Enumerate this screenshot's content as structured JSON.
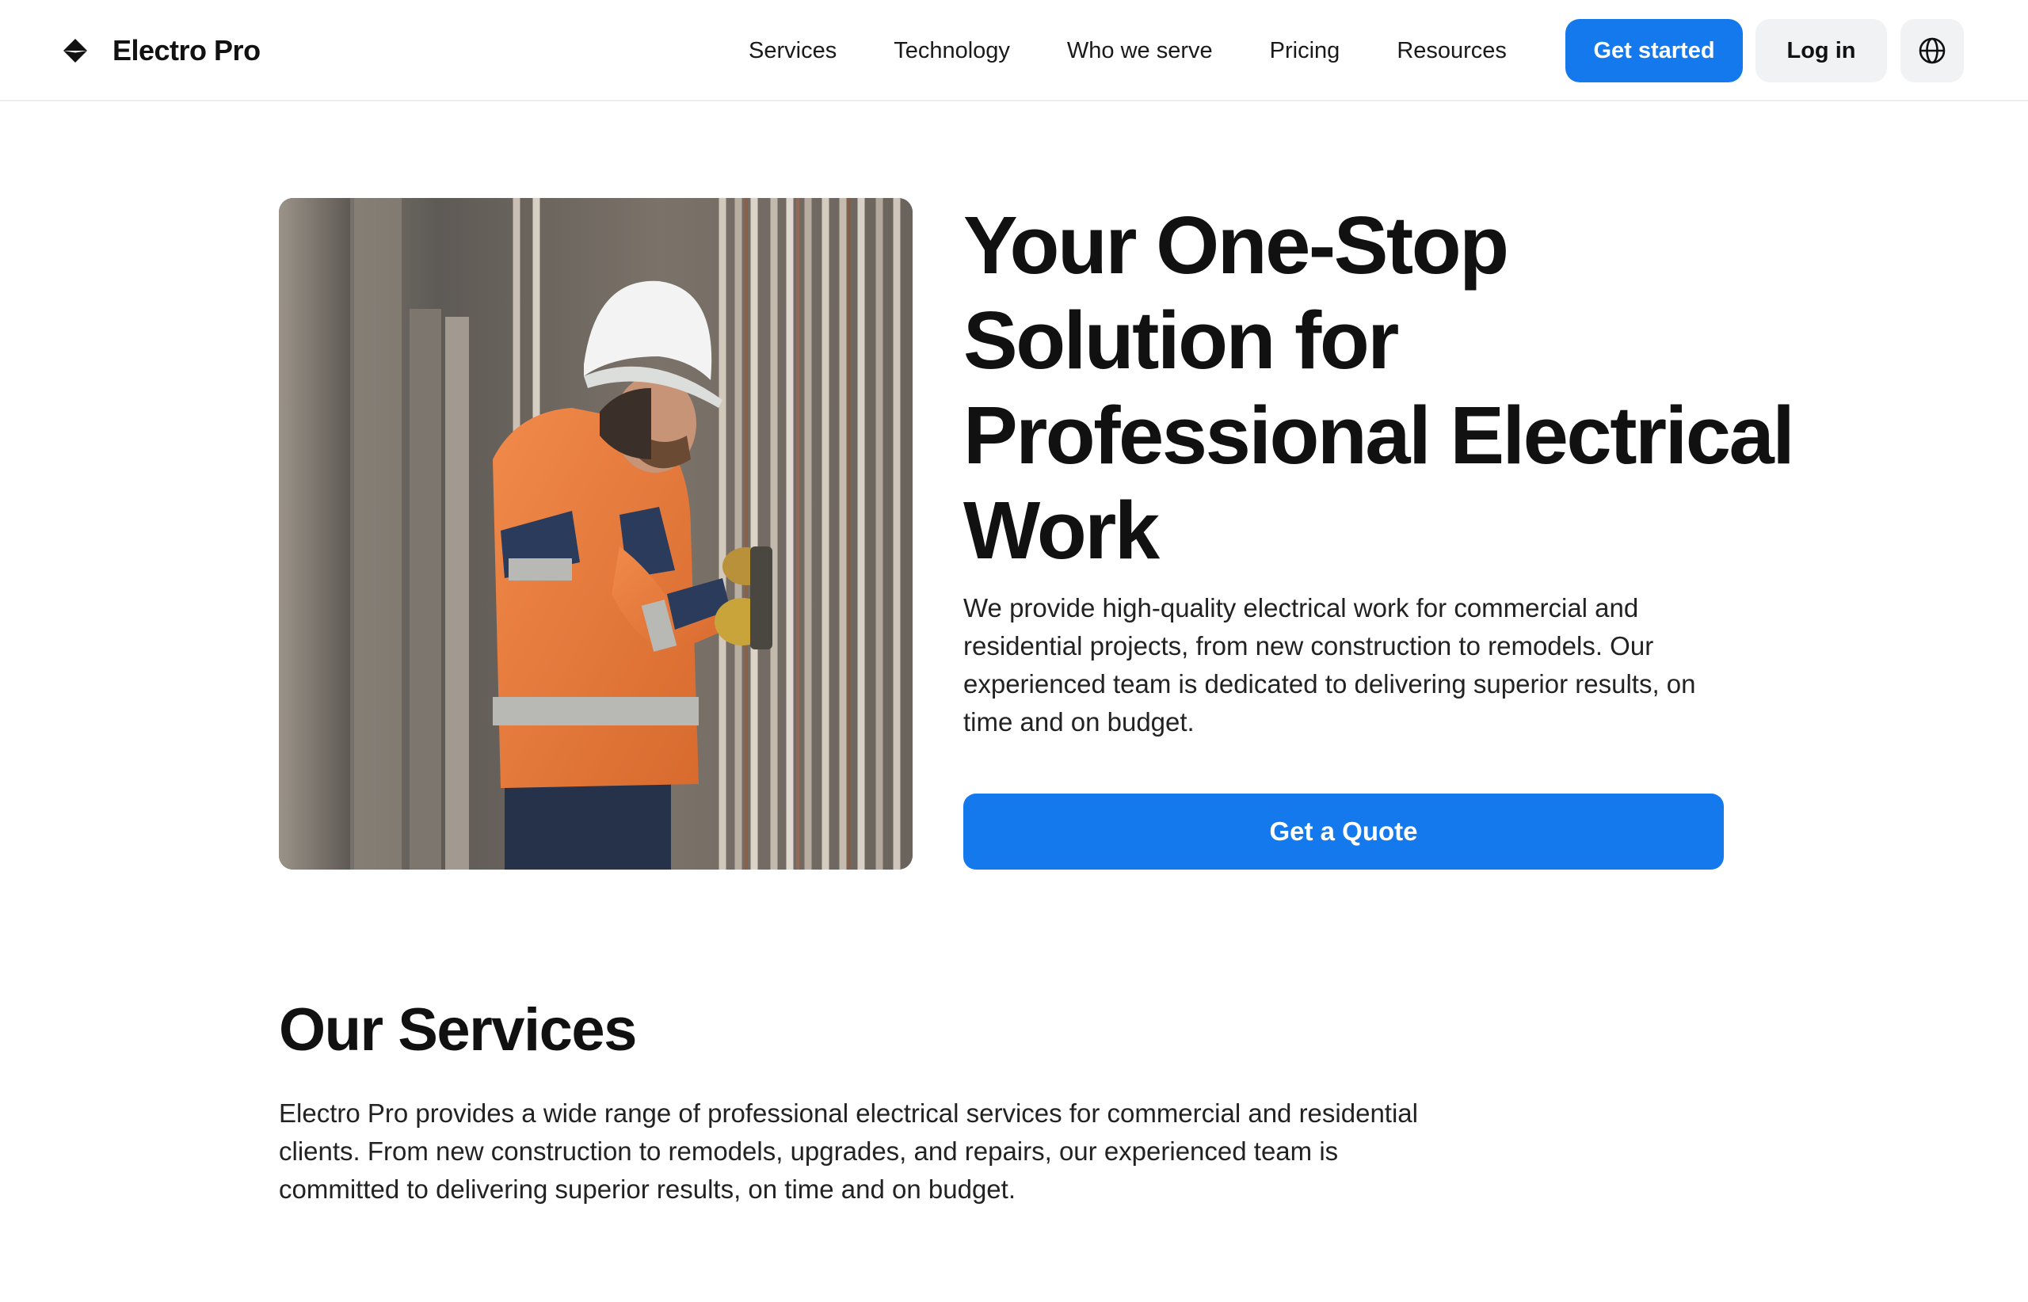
{
  "brand": {
    "name": "Electro Pro"
  },
  "nav": {
    "items": [
      {
        "label": "Services"
      },
      {
        "label": "Technology"
      },
      {
        "label": "Who we serve"
      },
      {
        "label": "Pricing"
      },
      {
        "label": "Resources"
      }
    ],
    "get_started_label": "Get started",
    "login_label": "Log in",
    "language_icon": "globe-icon"
  },
  "hero": {
    "title": "Your One-Stop Solution for Professional Electrical Work",
    "description": "We provide high-quality electrical work for commercial and residential projects, from new construction to remodels. Our experienced team is dedicated to delivering superior results, on time and on budget.",
    "cta_label": "Get a Quote"
  },
  "services": {
    "title": "Our Services",
    "description": "Electro Pro provides a wide range of professional electrical services for commercial and residential clients. From new construction to remodels, upgrades, and repairs, our experienced team is committed to delivering superior results, on time and on budget."
  },
  "colors": {
    "accent": "#1579ee",
    "secondary_button": "#f1f2f4",
    "text": "#111111"
  }
}
